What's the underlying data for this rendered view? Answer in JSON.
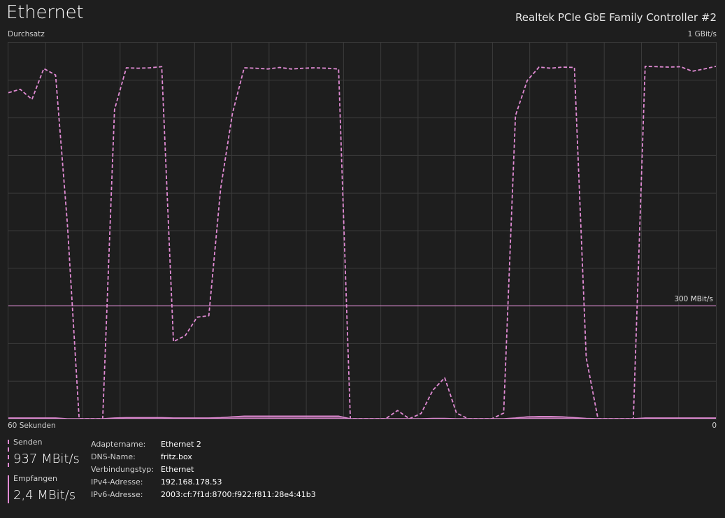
{
  "header": {
    "title": "Ethernet",
    "adapter_description": "Realtek PCIe GbE Family Controller #2"
  },
  "graph": {
    "label_top_left": "Durchsatz",
    "label_top_right": "1 GBit/s",
    "label_bottom_left": "60 Sekunden",
    "label_bottom_right": "0",
    "scale_line_label": "300 MBit/s",
    "colors": {
      "line": "#e18bd4",
      "grid": "#3b3b3b",
      "background": "#1e1e1e"
    }
  },
  "chart_data": {
    "type": "line",
    "ylabel": "Durchsatz",
    "ylim": [
      0,
      1000
    ],
    "xlim": [
      60,
      0
    ],
    "x_unit": "seconds",
    "y_unit": "MBit/s",
    "reference_line": {
      "label": "300 MBit/s",
      "value": 300
    },
    "x": [
      60,
      59,
      58,
      57,
      56,
      55,
      54,
      53,
      52,
      51,
      50,
      49,
      48,
      47,
      46,
      45,
      44,
      43,
      42,
      41,
      40,
      39,
      38,
      37,
      36,
      35,
      34,
      33,
      32,
      31,
      30,
      29,
      28,
      27,
      26,
      25,
      24,
      23,
      22,
      21,
      20,
      19,
      18,
      17,
      16,
      15,
      14,
      13,
      12,
      11,
      10,
      9,
      8,
      7,
      6,
      5,
      4,
      3,
      2,
      1,
      0
    ],
    "series": [
      {
        "name": "Senden",
        "style": "dashed",
        "values": [
          867,
          876,
          849,
          931,
          914,
          520,
          0,
          0,
          0,
          822,
          933,
          932,
          933,
          936,
          205,
          221,
          270,
          274,
          612,
          812,
          933,
          932,
          930,
          934,
          930,
          932,
          933,
          932,
          930,
          0,
          0,
          0,
          0,
          22,
          0,
          14,
          76,
          109,
          15,
          0,
          0,
          0,
          15,
          806,
          899,
          935,
          932,
          935,
          934,
          162,
          0,
          0,
          0,
          0,
          937,
          936,
          935,
          936,
          924,
          930,
          937
        ]
      },
      {
        "name": "Empfangen",
        "style": "solid-filled",
        "values": [
          2,
          2,
          2,
          2,
          2,
          0,
          0,
          0,
          0,
          2,
          3,
          3,
          3,
          3,
          2,
          2,
          2,
          2,
          3,
          5,
          7,
          7,
          7,
          7,
          7,
          7,
          7,
          7,
          7,
          0,
          0,
          0,
          0,
          0,
          0,
          0,
          1,
          1,
          0,
          0,
          0,
          0,
          0,
          2,
          5,
          6,
          6,
          5,
          3,
          1,
          0,
          0,
          0,
          0,
          2,
          2,
          2,
          2,
          2,
          2,
          2
        ]
      }
    ]
  },
  "legend": {
    "send": {
      "label": "Senden",
      "value": "937 MBit/s"
    },
    "receive": {
      "label": "Empfangen",
      "value": "2,4 MBit/s"
    }
  },
  "details": [
    {
      "key": "Adaptername:",
      "value": "Ethernet 2"
    },
    {
      "key": "DNS-Name:",
      "value": "fritz.box"
    },
    {
      "key": "Verbindungstyp:",
      "value": "Ethernet"
    },
    {
      "key": "IPv4-Adresse:",
      "value": "192.168.178.53"
    },
    {
      "key": "IPv6-Adresse:",
      "value": "2003:cf:7f1d:8700:f922:f811:28e4:41b3"
    }
  ]
}
